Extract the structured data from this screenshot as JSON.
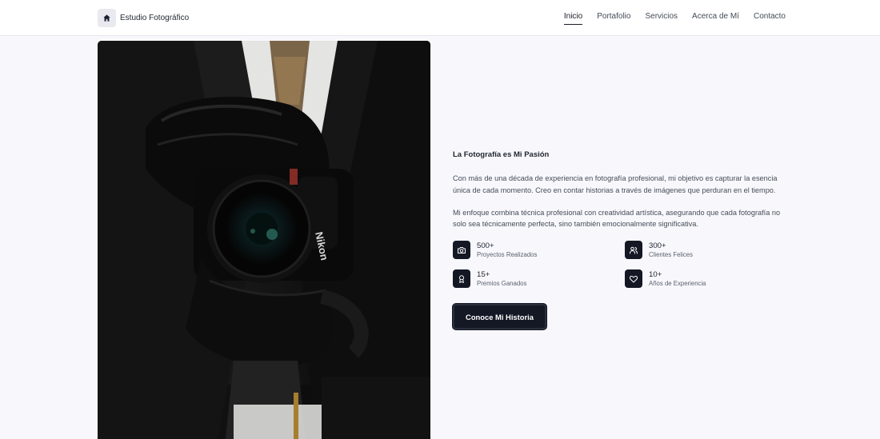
{
  "header": {
    "brand_name": "Estudio Fotográfico",
    "brand_icon": "home-icon",
    "nav": [
      {
        "label": "Inicio",
        "active": true
      },
      {
        "label": "Portafolio",
        "active": false
      },
      {
        "label": "Servicios",
        "active": false
      },
      {
        "label": "Acerca de Mí",
        "active": false
      },
      {
        "label": "Contacto",
        "active": false
      }
    ]
  },
  "photo": {
    "subject": "photographer-holding-camera",
    "camera_brand_text": "Nikon"
  },
  "about": {
    "headline": "La Fotografía es Mi Pasión",
    "paragraph_1": "Con más de una década de experiencia en fotografía profesional, mi objetivo es capturar la esencia única de cada momento. Creo en contar historias a través de imágenes que perduran en el tiempo.",
    "paragraph_2": "Mi enfoque combina técnica profesional con creatividad artística, asegurando que cada fotografía no solo sea técnicamente perfecta, sino también emocionalmente significativa.",
    "stats": [
      {
        "value": "500+",
        "label": "Proyectos Realizados",
        "icon": "camera-icon"
      },
      {
        "value": "300+",
        "label": "Clientes Felices",
        "icon": "users-icon"
      },
      {
        "value": "15+",
        "label": "Premios Ganados",
        "icon": "award-icon"
      },
      {
        "value": "10+",
        "label": "Años de Experiencia",
        "icon": "heart-icon"
      }
    ],
    "cta_label": "Conoce Mi Historia"
  },
  "colors": {
    "page_bg": "#f8f8fc",
    "accent_dark": "#141825",
    "header_bg": "#ffffff"
  }
}
